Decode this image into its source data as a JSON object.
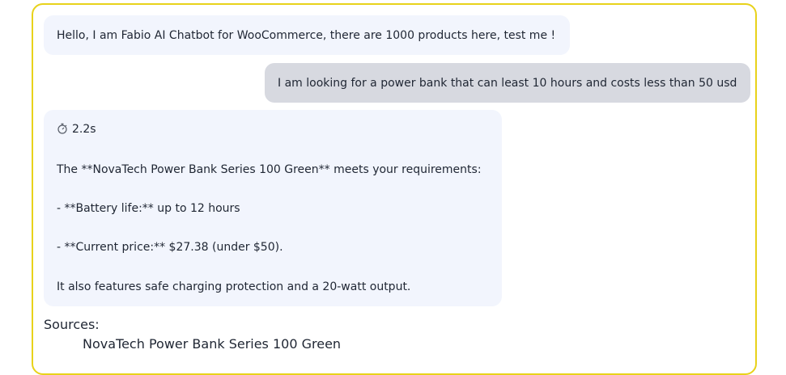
{
  "chat": {
    "greeting": "Hello, I am Fabio AI Chatbot for WooCommerce, there are 1000 products here, test me !",
    "user_message": "I am looking for a power bank that can least 10 hours and costs less than 50 usd",
    "response": {
      "timer_icon": "stopwatch-icon",
      "elapsed": "2.2s",
      "lines": [
        "The **NovaTech Power Bank Series 100 Green** meets your requirements:",
        "- **Battery life:** up to 12 hours",
        "- **Current price:** $27.38 (under $50).",
        "It also features safe charging protection and a 20-watt output."
      ]
    },
    "sources_label": "Sources:",
    "sources": [
      "NovaTech Power Bank Series 100 Green"
    ]
  },
  "colors": {
    "frame_border": "#e8d21a",
    "bot_bubble": "#f2f5fd",
    "user_bubble": "#d7d9e0",
    "text": "#1f2633"
  }
}
